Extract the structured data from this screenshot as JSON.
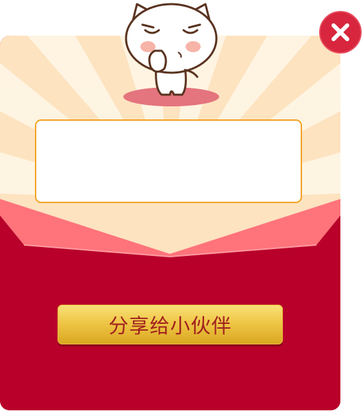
{
  "dialog": {
    "share_button_label": "分享给小伙伴",
    "message_text": ""
  },
  "icons": {
    "close": "close-icon",
    "mascot": "cat-mascot-icon"
  },
  "colors": {
    "envelope_red": "#b8002a",
    "flap_pink": "#ff6a72",
    "button_gold": "#efc646",
    "button_text": "#a0211f",
    "box_border": "#f2a324",
    "close_red": "#d7263d"
  }
}
